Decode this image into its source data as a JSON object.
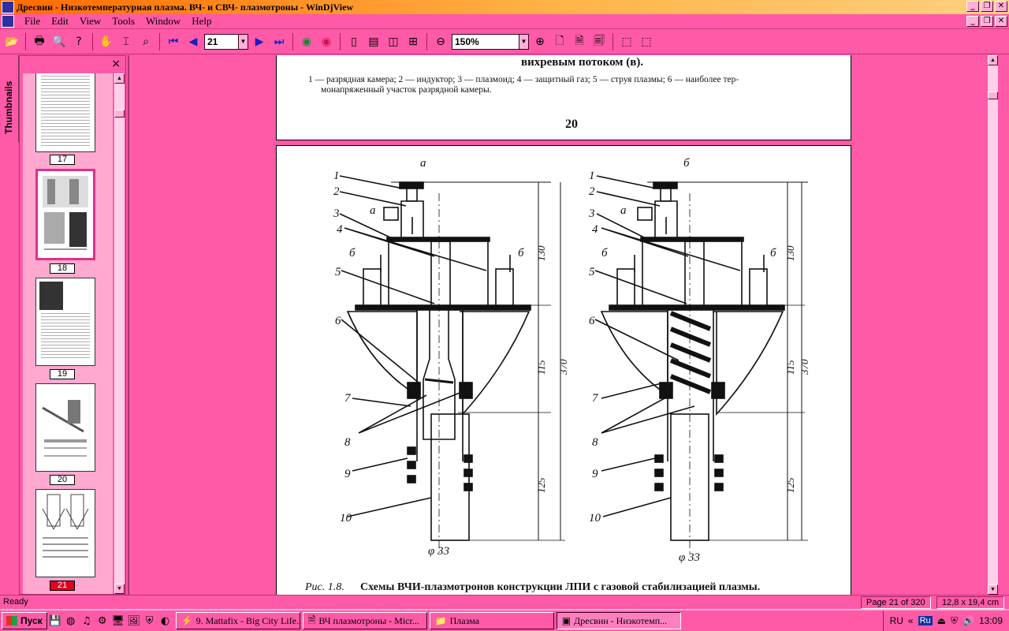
{
  "window": {
    "title": "Дресвин - Низкотемпературная плазма. ВЧ- и СВЧ- плазмотроны - WinDjView",
    "controls": [
      "_",
      "❐",
      "✕"
    ],
    "doc_controls": [
      "_",
      "❐",
      "✕"
    ]
  },
  "menu": [
    "File",
    "Edit",
    "View",
    "Tools",
    "Window",
    "Help"
  ],
  "toolbar": {
    "page_number": "21",
    "zoom": "150%"
  },
  "sidebar": {
    "tab_label": "Thumbnails",
    "close": "×",
    "thumbnails": [
      {
        "label": "17"
      },
      {
        "label": "18"
      },
      {
        "label": "19"
      },
      {
        "label": "20"
      },
      {
        "label": "21"
      }
    ]
  },
  "document": {
    "page_top": {
      "heading_fragment": "вихревым потоком (в).",
      "legend_line1": "1 — разрядная камера; 2 — индуктор; 3 — плазмоид; 4 — защитный газ; 5 — струя плазмы; 6 — наиболее тер-",
      "legend_line2": "монапряженный участок разрядной камеры.",
      "page_number": "20"
    },
    "figure": {
      "label_a": "а",
      "label_b": "б",
      "inlet_a": "а",
      "inlet_b": "б",
      "callouts": [
        "1",
        "2",
        "3",
        "4",
        "5",
        "6",
        "7",
        "8",
        "9",
        "10"
      ],
      "dims": [
        "130",
        "115",
        "370",
        "125"
      ],
      "diameter": "φ 33",
      "caption_prefix": "Рис. 1.8.",
      "caption_text": "Схемы ВЧИ-плазмотронов конструкции ЛПИ с газовой стабилизацией плазмы."
    }
  },
  "status": {
    "left": "Ready",
    "page": "Page 21 of 320",
    "size": "12,8 x 19,4 cm"
  },
  "taskbar": {
    "start": "Пуск",
    "tasks": [
      "9. Mattafix - Big City Life...",
      "ВЧ плазмотроны - Micr...",
      "Плазма",
      "Дресвин - Низкотемп..."
    ],
    "lang": "RU",
    "kbd": "Ru",
    "clock": "13:09"
  }
}
